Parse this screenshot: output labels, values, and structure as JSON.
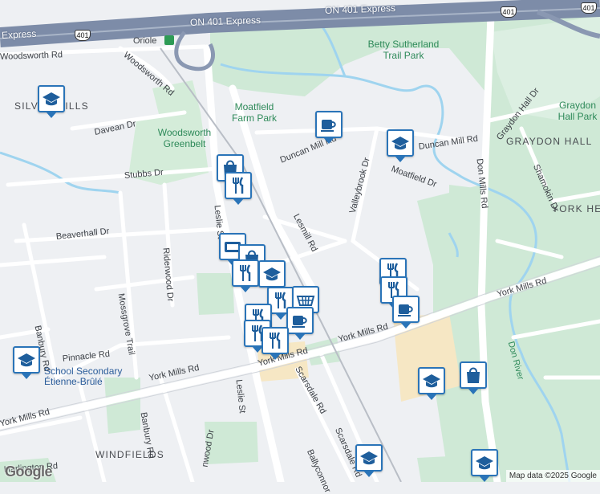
{
  "map": {
    "highway_labels": [
      "ON 401 Express",
      "Express"
    ],
    "highway_shields": [
      "401",
      "401",
      "401"
    ],
    "parks": [
      {
        "name": "Betty Sutherland Trail Park"
      },
      {
        "name": "Moatfield Farm Park"
      },
      {
        "name": "Woodsworth Greenbelt"
      },
      {
        "name": "Graydon Hall Park"
      }
    ],
    "areas": [
      "SILVER HILLS",
      "GRAYDON HALL",
      "YORK HE",
      "WINDFIELDS"
    ],
    "roads": [
      "Woodsworth Rd",
      "Woodsworth Rd",
      "Davean Dr",
      "Stubbs Dr",
      "Beaverhall Dr",
      "Riderwood Dr",
      "Mossgrove Trail",
      "Banbury Rd",
      "Pinnacle Rd",
      "York Mills Rd",
      "York Mills Rd",
      "York Mills Rd",
      "York Mills Rd",
      "Leslie St",
      "Leslie St",
      "Lesmill Rd",
      "Duncan Mill Rd",
      "Duncan Mill Rd",
      "Valleybrook Dr",
      "Moatfield Dr",
      "Don Mills Rd",
      "Graydon Hall Dr",
      "Shamokin Dr",
      "Scarsdale Rd",
      "Scarsdale Rd",
      "Banbury Rd",
      "Harlington Rd",
      "Ballyconnor",
      "nwood Dr",
      "Don River",
      "Oriole",
      "Rd",
      "Rd",
      "e Rd",
      "e Dr",
      "Banbury Rd",
      "Rd",
      "Oriole"
    ],
    "school_label": "School Secondary\nÉtienne-Brûlé",
    "pins": [
      {
        "icon": "school-icon"
      },
      {
        "icon": "cafe-icon"
      },
      {
        "icon": "school-icon"
      },
      {
        "icon": "shopping-icon"
      },
      {
        "icon": "restaurant-icon"
      },
      {
        "icon": "hotel-icon"
      },
      {
        "icon": "shopping-icon"
      },
      {
        "icon": "restaurant-icon"
      },
      {
        "icon": "school-icon"
      },
      {
        "icon": "restaurant-icon"
      },
      {
        "icon": "grocery-icon"
      },
      {
        "icon": "restaurant-icon"
      },
      {
        "icon": "cafe-icon"
      },
      {
        "icon": "restaurant-icon"
      },
      {
        "icon": "restaurant-icon"
      },
      {
        "icon": "restaurant-icon"
      },
      {
        "icon": "cafe-icon"
      },
      {
        "icon": "school-icon"
      },
      {
        "icon": "shopping-icon"
      },
      {
        "icon": "school-icon"
      },
      {
        "icon": "school-icon"
      },
      {
        "icon": "school-icon"
      }
    ],
    "attribution": "Map data ©2025 Google",
    "logo": "Google"
  }
}
